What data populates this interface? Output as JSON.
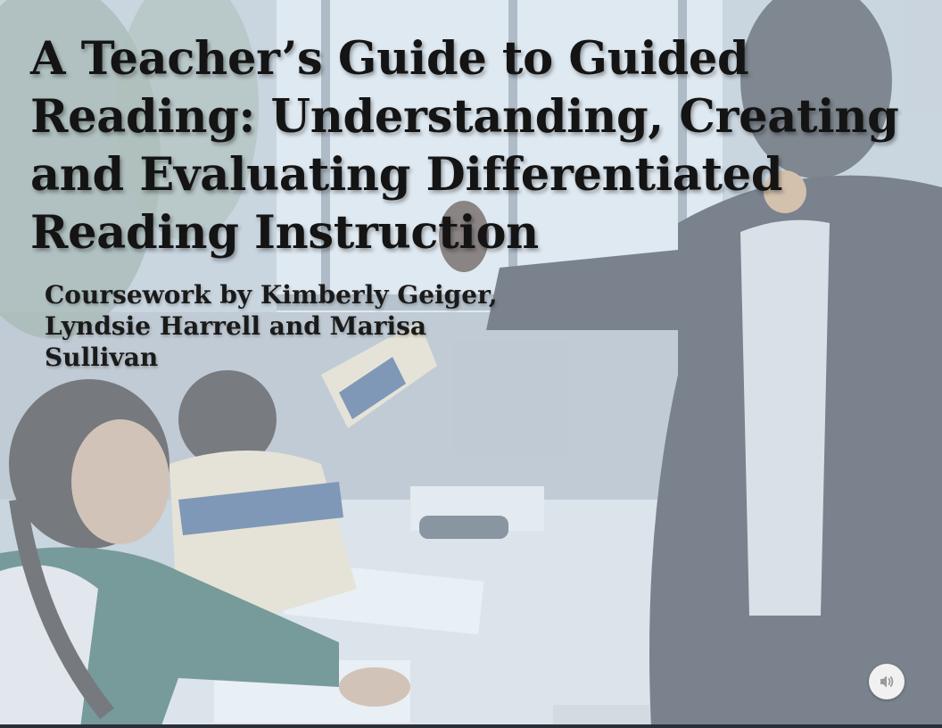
{
  "slide": {
    "title_lines": [
      "A Teacher’s Guide to Guided",
      "Reading: Understanding, Creating",
      "and Evaluating Differentiated",
      "Reading Instruction"
    ],
    "subtitle_lines": [
      "Coursework by Kimberly Geiger,",
      "Lyndsie Harrell and Marisa",
      "Sullivan"
    ],
    "background_photo": "classroom scene: teacher giving high-five to students at table"
  },
  "controls": {
    "audio_icon": "speaker-icon"
  },
  "colors": {
    "title_text": "#141414",
    "overlay": "#e1ebf6",
    "button_bg": "#f1f1f1",
    "icon": "#9a9a9a"
  }
}
